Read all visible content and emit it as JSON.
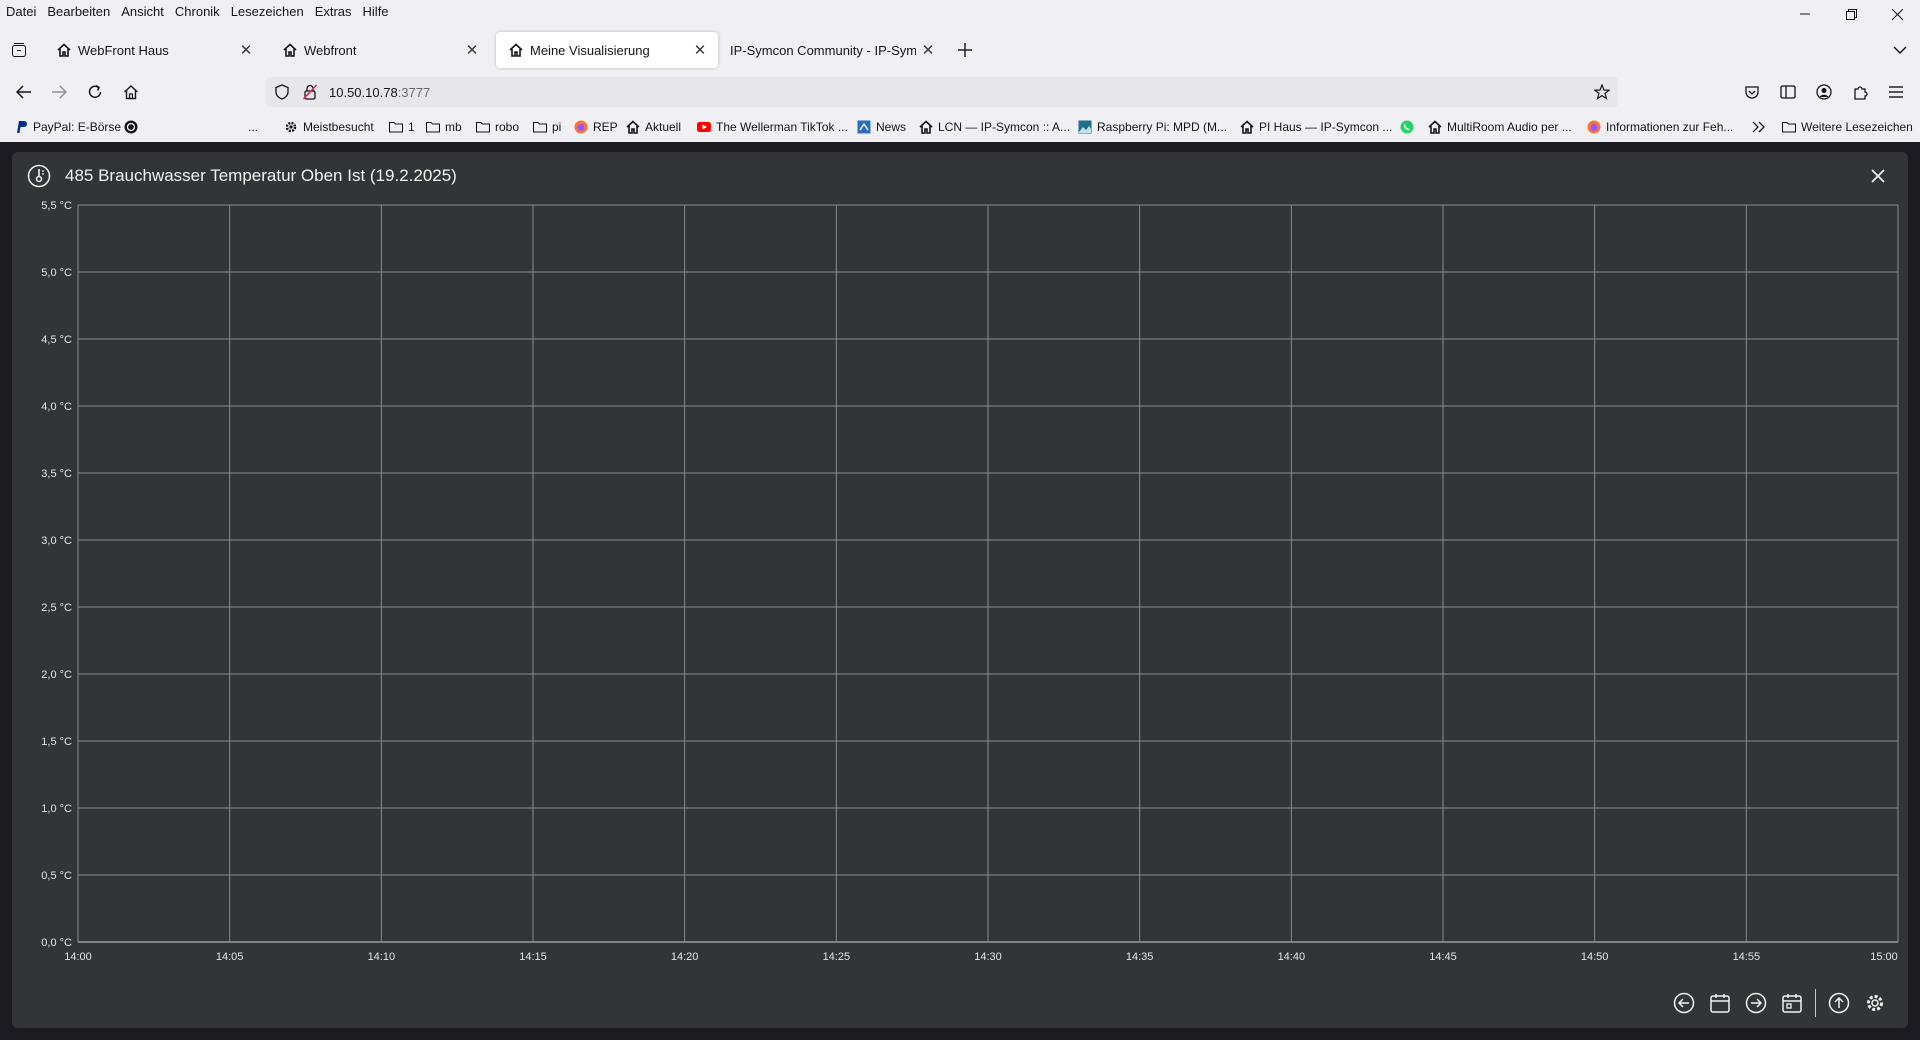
{
  "menu": [
    "Datei",
    "Bearbeiten",
    "Ansicht",
    "Chronik",
    "Lesezeichen",
    "Extras",
    "Hilfe"
  ],
  "tabs": [
    {
      "title": "WebFront Haus",
      "active": false
    },
    {
      "title": "Webfront",
      "active": false
    },
    {
      "title": "Meine Visualisierung",
      "active": true
    },
    {
      "title": "IP-Symcon Community - IP-Symcon",
      "active": false
    }
  ],
  "url": {
    "host": "10.50.10.78",
    "port": ":3777"
  },
  "bookmarks": [
    {
      "label": "PayPal: E-Börse",
      "icon": "paypal-icon"
    },
    {
      "label": "",
      "icon": "circle-logo-icon"
    },
    {
      "label": "...",
      "icon": ""
    },
    {
      "label": "Meistbesucht",
      "icon": "gear-icon"
    },
    {
      "label": "1",
      "icon": "folder-icon"
    },
    {
      "label": "mb",
      "icon": "folder-icon"
    },
    {
      "label": "robo",
      "icon": "folder-icon"
    },
    {
      "label": "pi",
      "icon": "folder-icon"
    },
    {
      "label": "REP",
      "icon": "firefox-icon"
    },
    {
      "label": "Aktuell",
      "icon": "house-icon"
    },
    {
      "label": "The Wellerman TikTok ...",
      "icon": "youtube-icon"
    },
    {
      "label": "News",
      "icon": "news-icon"
    },
    {
      "label": "LCN — IP-Symcon :: A...",
      "icon": "house-icon"
    },
    {
      "label": "Raspberry Pi: MPD (M...",
      "icon": "image-icon"
    },
    {
      "label": "PI Haus — IP-Symcon ...",
      "icon": "house-icon"
    },
    {
      "label": "",
      "icon": "whatsapp-icon"
    },
    {
      "label": "MultiRoom Audio per ...",
      "icon": "house-icon"
    },
    {
      "label": "Informationen zur Feh...",
      "icon": "firefox-icon"
    },
    {
      "label": "Weitere Lesezeichen",
      "icon": "folder-icon"
    }
  ],
  "dialog": {
    "title": "485 Brauchwasser Temperatur Oben Ist (19.2.2025)"
  },
  "colors": {
    "background": "#333438",
    "grid": "#8a8b8f",
    "text": "#e6e6e6"
  },
  "chart_data": {
    "type": "line",
    "title": "485 Brauchwasser Temperatur Oben Ist (19.2.2025)",
    "x": [],
    "series": [],
    "ylim": [
      0.0,
      5.5
    ],
    "y_ticks": [
      "0,0 °C",
      "0,5 °C",
      "1,0 °C",
      "1,5 °C",
      "2,0 °C",
      "2,5 °C",
      "3,0 °C",
      "3,5 °C",
      "4,0 °C",
      "4,5 °C",
      "5,0 °C",
      "5,5 °C"
    ],
    "x_ticks": [
      "14:00",
      "14:05",
      "14:10",
      "14:15",
      "14:20",
      "14:25",
      "14:30",
      "14:35",
      "14:40",
      "14:45",
      "14:50",
      "14:55",
      "15:00"
    ],
    "grid": true,
    "legend": "none"
  }
}
